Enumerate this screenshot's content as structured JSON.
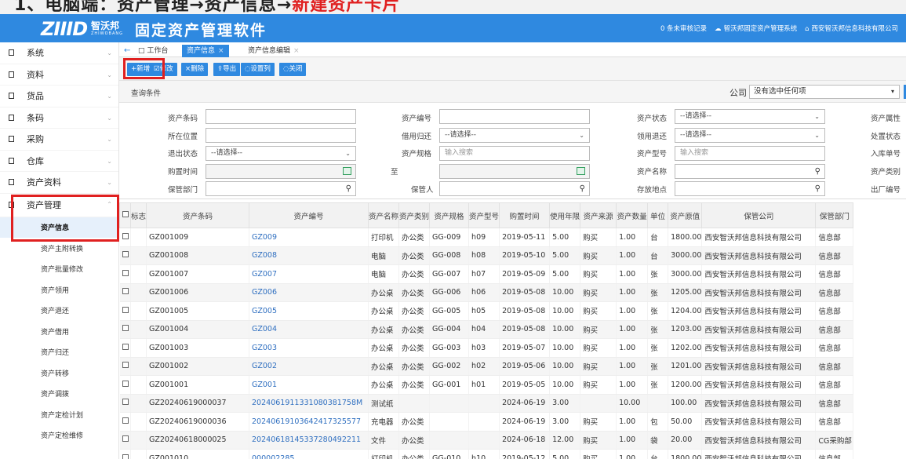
{
  "top_strip": {
    "text_black": "1、电脑端：资产管理→资产信息→",
    "text_red": "新建资产卡片"
  },
  "header": {
    "logo": "ZIIID",
    "brand": "智沃邦",
    "brand_en": "ZHIWOBANG",
    "title": "固定资产管理软件",
    "pending": "0 条未审核记录",
    "system_link": "智沃邦固定资产管理系统",
    "company_link": "西安智沃邦信息科技有限公司"
  },
  "sidebar": {
    "items": [
      "系统",
      "资料",
      "货品",
      "条码",
      "采购",
      "仓库",
      "资产资料"
    ],
    "expanded": "资产管理",
    "sub_items": [
      "资产信息",
      "资产主附转换",
      "资产批量修改",
      "资产领用",
      "资产退还",
      "资产借用",
      "资产归还",
      "资产转移",
      "资产调拨",
      "资产定检计划",
      "资产定检维修"
    ]
  },
  "tabs": {
    "back": "←",
    "workbench": "工作台",
    "active": "资产信息",
    "edit": "资产信息编辑",
    "close": "×"
  },
  "toolbar": {
    "new": "+新增",
    "edit": "修改",
    "delete": "×删除",
    "export": "导出",
    "columns": "设置列",
    "close": "关闭"
  },
  "query": {
    "label": "查询条件",
    "company_label": "公司",
    "company_value": "没有选中任何项"
  },
  "form": {
    "labels": {
      "asset_barcode": "资产条码",
      "location": "所在位置",
      "exit_status": "退出状态",
      "purchase_time": "购置时间",
      "custodian_dept": "保管部门",
      "asset_no": "资产编号",
      "borrow_return": "借用归还",
      "spec": "资产规格",
      "to": "至",
      "custodian": "保管人",
      "asset_status": "资产状态",
      "use_return": "领用退还",
      "model": "资产型号",
      "asset_name": "资产名称",
      "storage": "存放地点",
      "attr": "资产属性",
      "dispose": "处置状态",
      "inbound": "入库单号",
      "category": "资产类别",
      "factory_no": "出厂编号"
    },
    "select_placeholder": "--请选择--",
    "search_placeholder": "输入搜索"
  },
  "table": {
    "headers": [
      "标志",
      "资产条码",
      "资产编号",
      "资产名称",
      "资产类别",
      "资产规格",
      "资产型号",
      "购置时间",
      "使用年限",
      "资产来源",
      "资产数量",
      "单位",
      "资产原值",
      "保管公司",
      "保管部门"
    ],
    "rows": [
      [
        "",
        "GZ001009",
        "GZ009",
        "打印机",
        "办公类",
        "GG-009",
        "h09",
        "2019-05-11",
        "5.00",
        "购买",
        "1.00",
        "台",
        "1800.00",
        "西安智沃邦信息科技有限公司",
        "信息部"
      ],
      [
        "",
        "GZ001008",
        "GZ008",
        "电脑",
        "办公类",
        "GG-008",
        "h08",
        "2019-05-10",
        "5.00",
        "购买",
        "1.00",
        "台",
        "3000.00",
        "西安智沃邦信息科技有限公司",
        "信息部"
      ],
      [
        "",
        "GZ001007",
        "GZ007",
        "电脑",
        "办公类",
        "GG-007",
        "h07",
        "2019-05-09",
        "5.00",
        "购买",
        "1.00",
        "张",
        "3000.00",
        "西安智沃邦信息科技有限公司",
        "信息部"
      ],
      [
        "",
        "GZ001006",
        "GZ006",
        "办公桌",
        "办公类",
        "GG-006",
        "h06",
        "2019-05-08",
        "10.00",
        "购买",
        "1.00",
        "张",
        "1205.00",
        "西安智沃邦信息科技有限公司",
        "信息部"
      ],
      [
        "",
        "GZ001005",
        "GZ005",
        "办公桌",
        "办公类",
        "GG-005",
        "h05",
        "2019-05-08",
        "10.00",
        "购买",
        "1.00",
        "张",
        "1204.00",
        "西安智沃邦信息科技有限公司",
        "信息部"
      ],
      [
        "",
        "GZ001004",
        "GZ004",
        "办公桌",
        "办公类",
        "GG-004",
        "h04",
        "2019-05-08",
        "10.00",
        "购买",
        "1.00",
        "张",
        "1203.00",
        "西安智沃邦信息科技有限公司",
        "信息部"
      ],
      [
        "",
        "GZ001003",
        "GZ003",
        "办公桌",
        "办公类",
        "GG-003",
        "h03",
        "2019-05-07",
        "10.00",
        "购买",
        "1.00",
        "张",
        "1202.00",
        "西安智沃邦信息科技有限公司",
        "信息部"
      ],
      [
        "",
        "GZ001002",
        "GZ002",
        "办公桌",
        "办公类",
        "GG-002",
        "h02",
        "2019-05-06",
        "10.00",
        "购买",
        "1.00",
        "张",
        "1201.00",
        "西安智沃邦信息科技有限公司",
        "信息部"
      ],
      [
        "",
        "GZ001001",
        "GZ001",
        "办公桌",
        "办公类",
        "GG-001",
        "h01",
        "2019-05-05",
        "10.00",
        "购买",
        "1.00",
        "张",
        "1200.00",
        "西安智沃邦信息科技有限公司",
        "信息部"
      ],
      [
        "",
        "GZ20240619000037",
        "2024061911331080381758M",
        "测试纸",
        "",
        "",
        "",
        "2024-06-19",
        "3.00",
        "",
        "10.00",
        "",
        "100.00",
        "西安智沃邦信息科技有限公司",
        "信息部"
      ],
      [
        "",
        "GZ20240619000036",
        "20240619103642417325577",
        "充电器",
        "办公类",
        "",
        "",
        "2024-06-19",
        "3.00",
        "购买",
        "1.00",
        "包",
        "50.00",
        "西安智沃邦信息科技有限公司",
        "信息部"
      ],
      [
        "",
        "GZ20240618000025",
        "20240618145337280492211",
        "文件",
        "办公类",
        "",
        "",
        "2024-06-18",
        "12.00",
        "购买",
        "1.00",
        "袋",
        "20.00",
        "西安智沃邦信息科技有限公司",
        "CG采购部"
      ],
      [
        "",
        "GZ001010",
        "000002285",
        "打印机",
        "办公类",
        "GG-010",
        "h10",
        "2019-05-12",
        "5.00",
        "购买",
        "1.00",
        "台",
        "1800.00",
        "西安智沃邦信息科技有限公司",
        "信息部"
      ]
    ]
  },
  "colors": {
    "primary": "#2f89e0",
    "highlight": "#e02020",
    "link": "#2f6fc0"
  }
}
